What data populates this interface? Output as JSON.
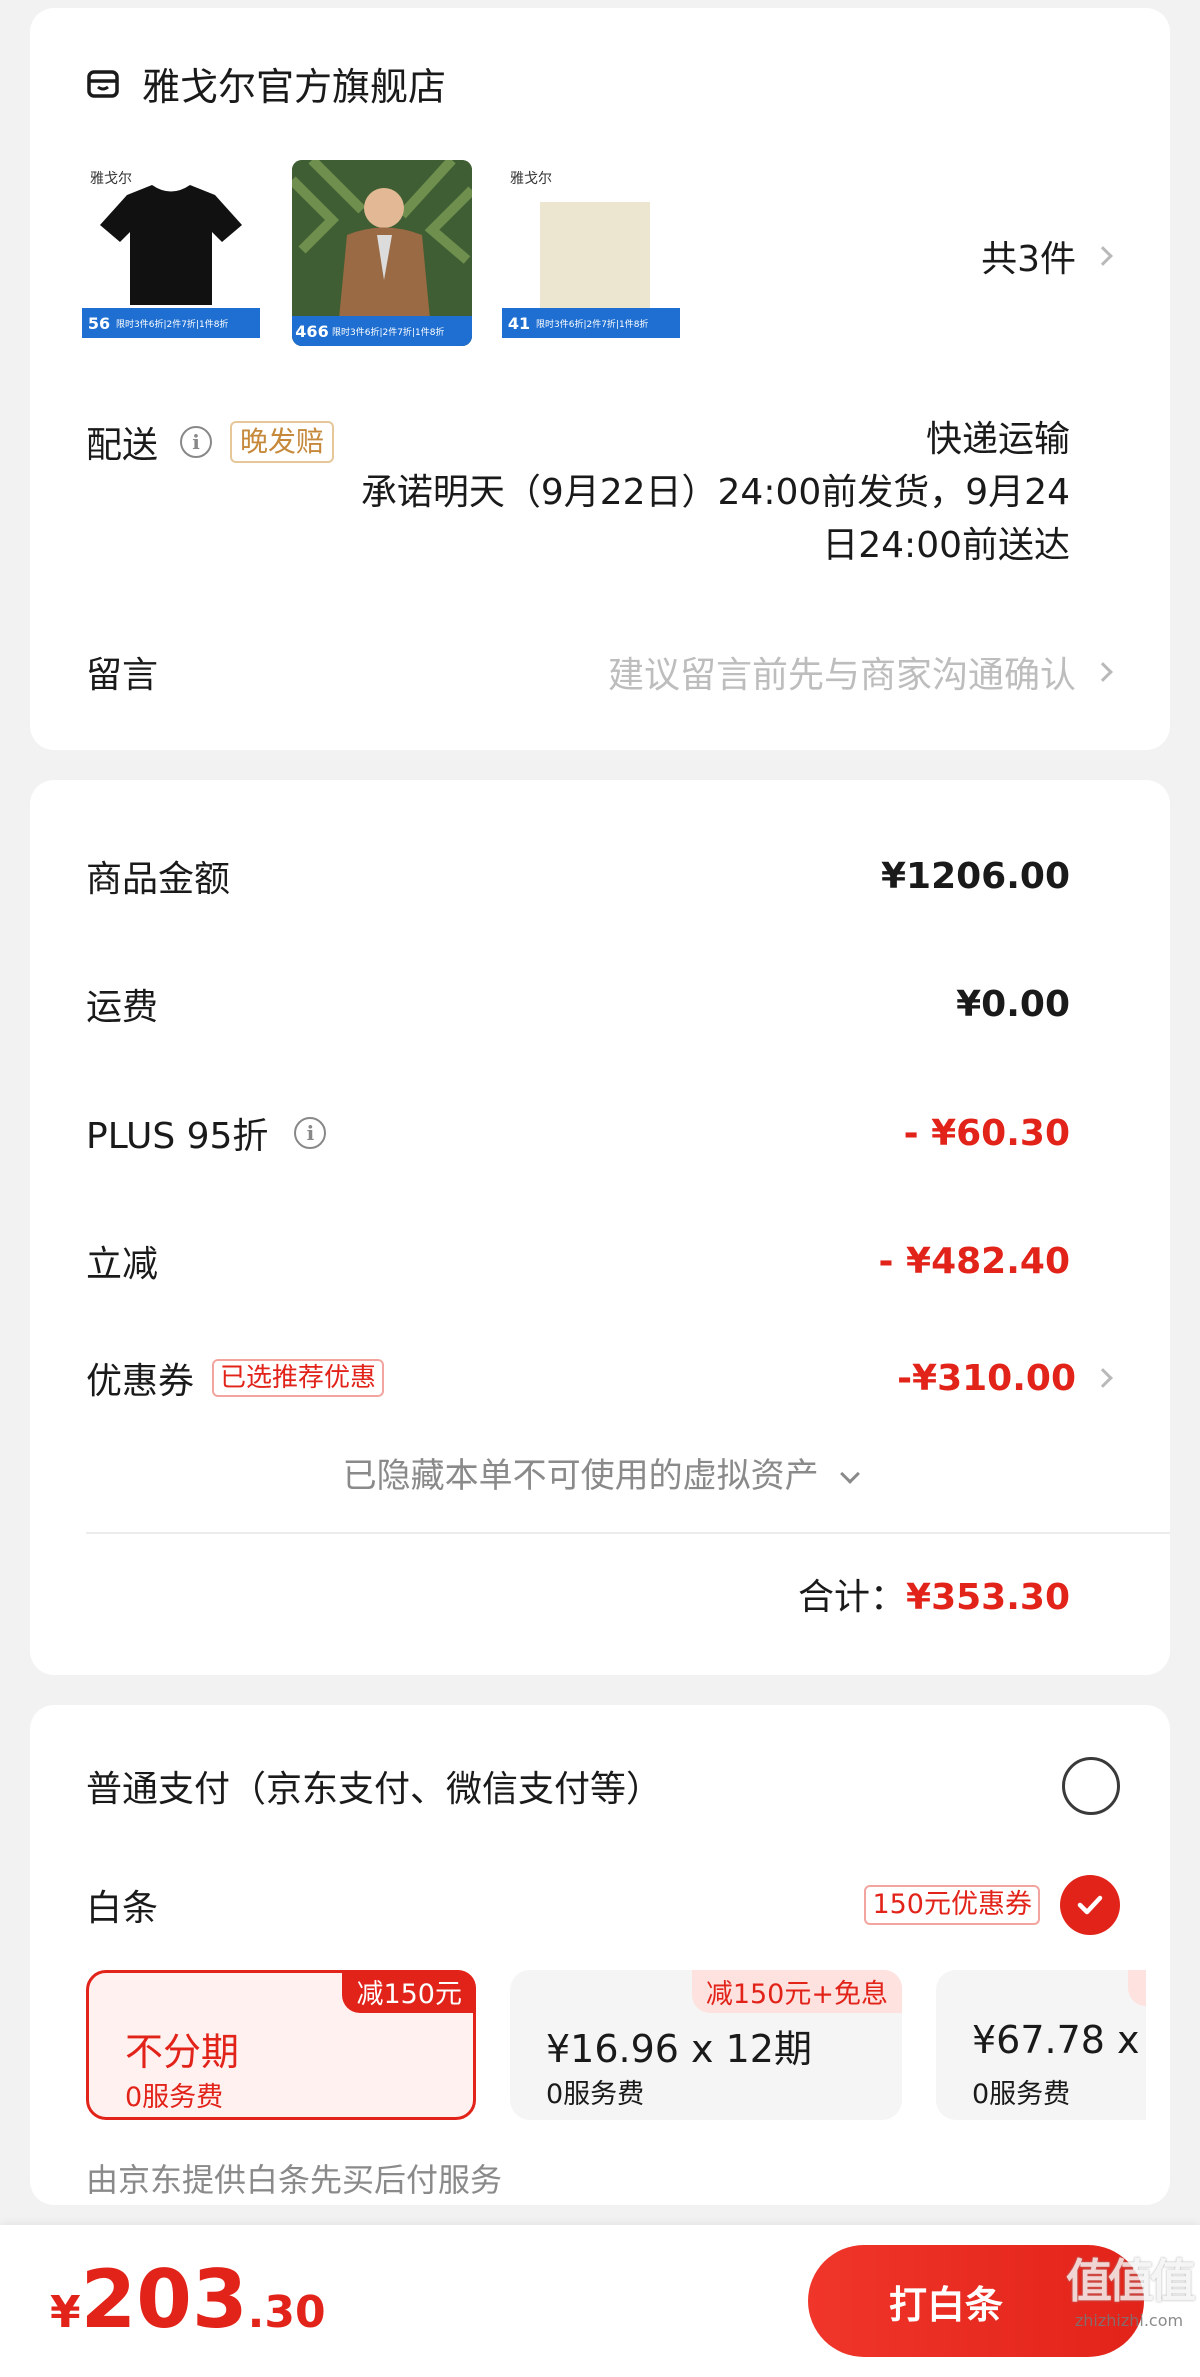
{
  "store": {
    "name": "雅戈尔官方旗舰店",
    "products": [
      {
        "tag": "雅戈尔",
        "badge": "56",
        "promo": "限时3件6折|2件7折|1件8折",
        "bg": "#ffffff",
        "item": "#111111"
      },
      {
        "tag": "",
        "badge": "466",
        "promo": "限时3件6折|2件7折|1件8折",
        "bg": "#4a6b3a",
        "item": "#9a6a44"
      },
      {
        "tag": "雅戈尔",
        "badge": "41",
        "promo": "限时3件6折|2件7折|1件8折",
        "bg": "#ffffff",
        "item": "#ece5cf"
      }
    ],
    "item_count": "共3件"
  },
  "delivery": {
    "label": "配送",
    "badge": "晚发赔",
    "method": "快递运输",
    "promise_line1": "承诺明天（9月22日）24:00前发货，9月24",
    "promise_line2": "日24:00前送达"
  },
  "message": {
    "label": "留言",
    "placeholder": "建议留言前先与商家沟通确认"
  },
  "summary": {
    "goods_label": "商品金额",
    "goods_value": "¥1206.00",
    "shipping_label": "运费",
    "shipping_value": "¥0.00",
    "plus_label": "PLUS 95折",
    "plus_value": "- ¥60.30",
    "instant_label": "立减",
    "instant_value": "- ¥482.40",
    "coupon_label": "优惠券",
    "coupon_badge": "已选推荐优惠",
    "coupon_value": "-¥310.00",
    "hidden_assets": "已隐藏本单不可使用的虚拟资产",
    "total_label": "合计：",
    "total_value": "¥353.30"
  },
  "payment": {
    "normal_label": "普通支付（京东支付、微信支付等）",
    "baitiao_label": "白条",
    "baitiao_coupon": "150元优惠券",
    "plans": [
      {
        "title": "不分期",
        "fee": "0服务费",
        "tag": "减150元",
        "selected": true
      },
      {
        "title": "¥16.96 x 12期",
        "fee": "0服务费",
        "tag": "减150元+免息",
        "selected": false
      },
      {
        "title": "¥67.78 x",
        "fee": "0服务费",
        "tag": "",
        "selected": false
      }
    ],
    "provider_note": "由京东提供白条先买后付服务"
  },
  "footer": {
    "currency": "¥",
    "price_int": "203",
    "price_dec": ".30",
    "pay_button": "打白条",
    "watermark_main": "值值值",
    "watermark_sub": "zhizhizhi.com"
  },
  "colors": {
    "accent": "#e2231a",
    "badge_gold": "#c6893b",
    "muted": "#999999"
  }
}
